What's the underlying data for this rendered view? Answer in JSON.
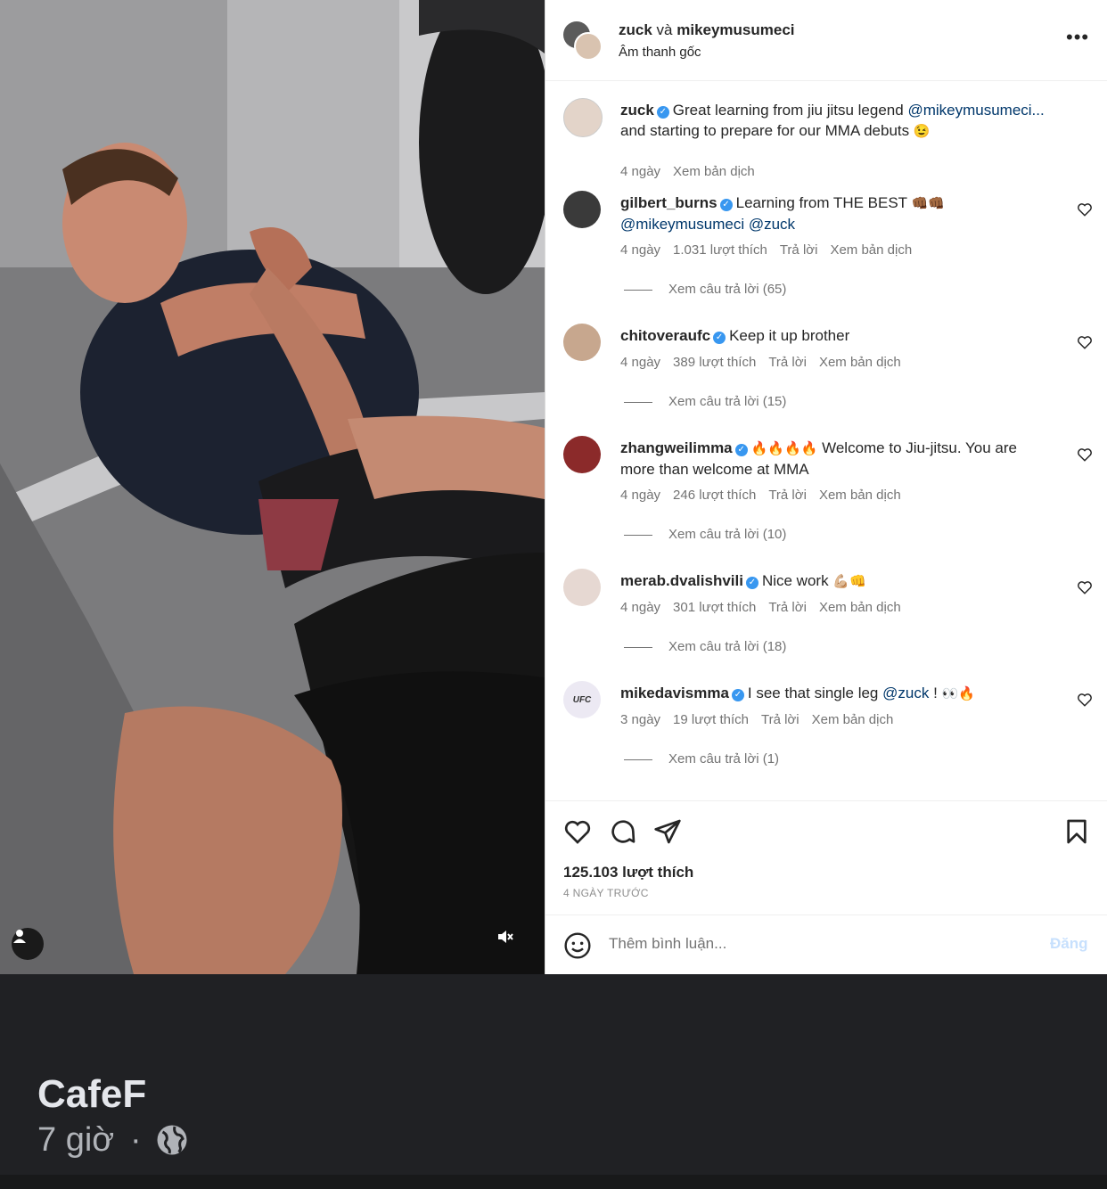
{
  "post": {
    "header_names": "zuck và mikeymusumeci",
    "header_user1": "zuck",
    "header_conj": "và",
    "header_user2": "mikeymusumeci",
    "audio": "Âm thanh gốc",
    "caption": {
      "user": "zuck",
      "text1": "Great learning from jiu jitsu legend ",
      "mention": "@mikeymusumeci...",
      "text2": "and starting to prepare for our MMA debuts",
      "emoji": "😉",
      "time": "4 ngày",
      "translate": "Xem bản dịch"
    },
    "comments": [
      {
        "user": "gilbert_burns",
        "text": "Learning from THE BEST",
        "emoji": "👊🏾👊🏾",
        "mentions": "@mikeymusumeci @zuck",
        "time": "4 ngày",
        "likes": "1.031 lượt thích",
        "reply": "Trả lời",
        "translate": "Xem bản dịch",
        "view_replies": "Xem câu trả lời (65)"
      },
      {
        "user": "chitoveraufc",
        "text": "Keep it up brother",
        "time": "4 ngày",
        "likes": "389 lượt thích",
        "reply": "Trả lời",
        "translate": "Xem bản dịch",
        "view_replies": "Xem câu trả lời (15)"
      },
      {
        "user": "zhangweilimma",
        "emoji": "🔥🔥🔥🔥",
        "text": "Welcome to Jiu-jitsu. You are",
        "text2": "more than welcome at MMA",
        "time": "4 ngày",
        "likes": "246 lượt thích",
        "reply": "Trả lời",
        "translate": "Xem bản dịch",
        "view_replies": "Xem câu trả lời (10)"
      },
      {
        "user": "merab.dvalishvili",
        "text": "Nice work",
        "emoji": "💪🏼👊",
        "time": "4 ngày",
        "likes": "301 lượt thích",
        "reply": "Trả lời",
        "translate": "Xem bản dịch",
        "view_replies": "Xem câu trả lời (18)"
      },
      {
        "user": "mikedavismma",
        "text": "I see that single leg ",
        "mention": "@zuck",
        "text_end": " !",
        "emoji": "👀🔥",
        "time": "3 ngày",
        "likes": "19 lượt thích",
        "reply": "Trả lời",
        "translate": "Xem bản dịch",
        "view_replies": "Xem câu trả lời (1)"
      }
    ],
    "likes_count": "125.103 lượt thích",
    "posted_ago": "4 NGÀY TRƯỚC",
    "comment_placeholder": "Thêm bình luận...",
    "post_button": "Đăng",
    "avatar_badge_text": "UFC"
  },
  "facebook": {
    "page_name": "CafeF",
    "time": "7 giờ",
    "separator": "·"
  },
  "icons": [
    "more-icon",
    "verified-icon",
    "heart-icon",
    "comment-icon",
    "share-icon",
    "bookmark-icon",
    "smile-icon",
    "user-tag-icon",
    "muted-icon",
    "globe-icon"
  ],
  "colors": {
    "verified": "#3897f0",
    "mention": "#00376b",
    "meta": "#737373",
    "post_disabled": "#c7e0fd",
    "fb_bg": "#202124"
  }
}
